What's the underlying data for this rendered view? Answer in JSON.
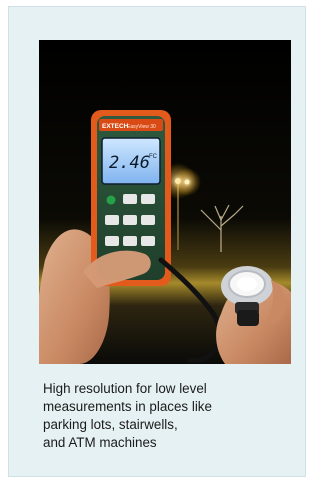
{
  "figure": {
    "meter": {
      "brand": "EXTECH",
      "model": "EasyView 30",
      "reading": "2.46",
      "unit": "FC"
    },
    "caption_lines": [
      "High resolution for low level",
      "measurements in places like",
      "parking lots, stairwells,",
      "and ATM machines"
    ]
  }
}
